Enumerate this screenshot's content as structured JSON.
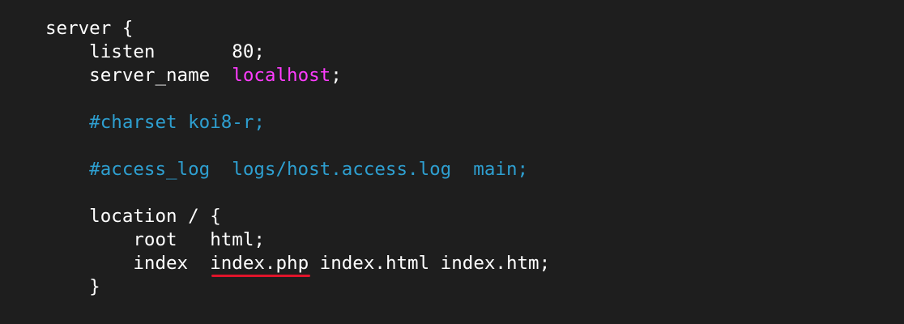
{
  "code": {
    "lines": [
      {
        "segments": [
          {
            "text": "server {",
            "style": "text"
          }
        ]
      },
      {
        "segments": [
          {
            "text": "    listen       80;",
            "style": "text"
          }
        ]
      },
      {
        "segments": [
          {
            "text": "    server_name  ",
            "style": "text"
          },
          {
            "text": "localhost",
            "style": "magenta"
          },
          {
            "text": ";",
            "style": "text"
          }
        ]
      },
      {
        "segments": [
          {
            "text": "",
            "style": "text"
          }
        ]
      },
      {
        "segments": [
          {
            "text": "    #charset koi8-r;",
            "style": "comment"
          }
        ]
      },
      {
        "segments": [
          {
            "text": "",
            "style": "text"
          }
        ]
      },
      {
        "segments": [
          {
            "text": "    #access_log  logs/host.access.log  main;",
            "style": "comment"
          }
        ]
      },
      {
        "segments": [
          {
            "text": "",
            "style": "text"
          }
        ]
      },
      {
        "segments": [
          {
            "text": "    location / {",
            "style": "text"
          }
        ]
      },
      {
        "segments": [
          {
            "text": "        root   html;",
            "style": "text"
          }
        ]
      },
      {
        "segments": [
          {
            "text": "        index  ",
            "style": "text"
          },
          {
            "text": "index.php",
            "style": "text",
            "underline": true
          },
          {
            "text": " index.html index.htm;",
            "style": "text"
          }
        ]
      },
      {
        "segments": [
          {
            "text": "    }",
            "style": "text"
          }
        ]
      }
    ]
  },
  "colors": {
    "background": "#1e1e1e",
    "text": "#ffffff",
    "keyword_value": "#ff3cff",
    "comment": "#2e9fd0",
    "underline": "#e0142a"
  }
}
